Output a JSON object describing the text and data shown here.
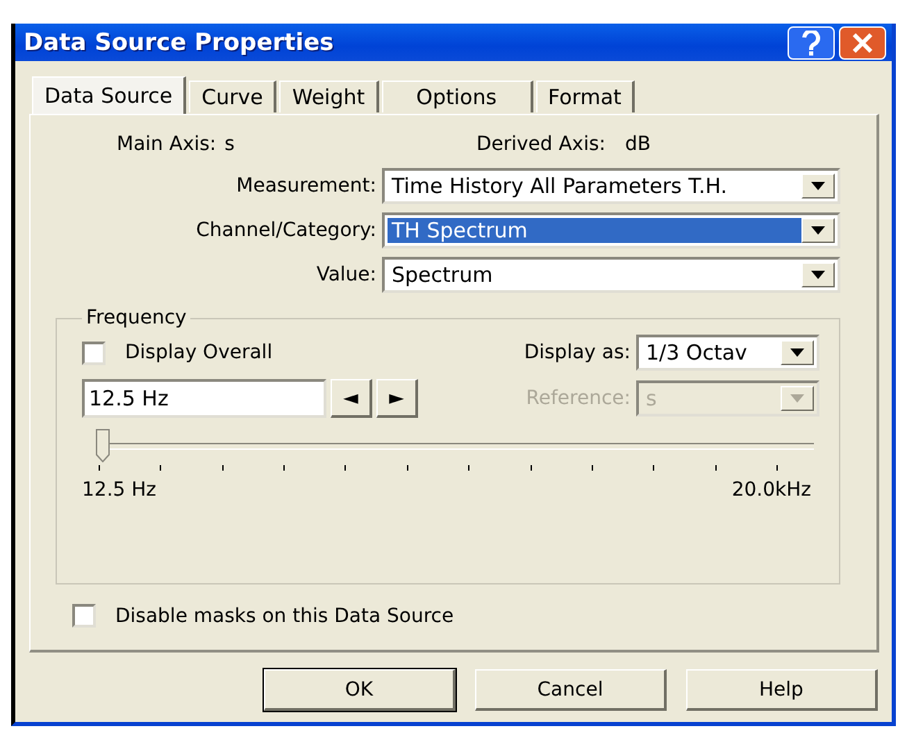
{
  "window": {
    "title": "Data Source Properties"
  },
  "tabs": [
    {
      "label": "Data Source",
      "selected": true
    },
    {
      "label": "Curve",
      "selected": false
    },
    {
      "label": "Weight",
      "selected": false
    },
    {
      "label": "Options",
      "selected": false
    },
    {
      "label": "Format",
      "selected": false
    }
  ],
  "axes": {
    "main_label": "Main Axis:",
    "main_value": "s",
    "derived_label": "Derived Axis:",
    "derived_value": "dB"
  },
  "fields": [
    {
      "label": "Measurement:",
      "value": "Time History All Parameters T.H.",
      "highlighted": false
    },
    {
      "label": "Channel/Category:",
      "value": "TH Spectrum",
      "highlighted": true
    },
    {
      "label": "Value:",
      "value": "Spectrum",
      "highlighted": false
    }
  ],
  "frequency": {
    "title": "Frequency",
    "display_overall": {
      "label": "Display Overall",
      "checked": false
    },
    "display_as": {
      "label": "Display as:",
      "value": "1/3 Octav",
      "disabled": false
    },
    "reference": {
      "label": "Reference:",
      "value": "s",
      "disabled": true
    },
    "input": {
      "value": "12.5 Hz"
    },
    "prev_button": "◄",
    "next_button": "►",
    "slider": {
      "level": 0,
      "min_label": "12.5 Hz",
      "max_label": "20.0kHz"
    }
  },
  "disable_masks": {
    "label": "Disable masks on this Data Source",
    "checked": false
  },
  "buttons": [
    {
      "label": "OK",
      "default": true
    },
    {
      "label": "Cancel",
      "default": false
    },
    {
      "label": "Help",
      "default": false
    }
  ]
}
